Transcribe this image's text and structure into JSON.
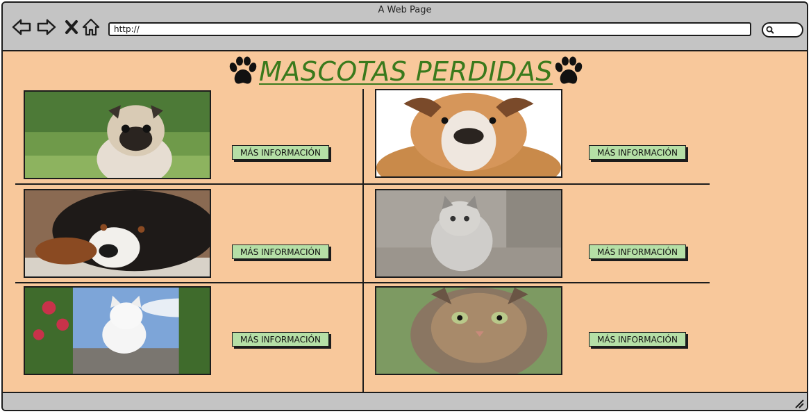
{
  "window": {
    "title": "A Web Page"
  },
  "browser": {
    "url": "http://",
    "icons": [
      "back-arrow-icon",
      "forward-arrow-icon",
      "close-x-icon",
      "home-icon",
      "search-icon",
      "resize-grip-icon"
    ]
  },
  "page": {
    "title": "MASCOTAS PERDIDAS",
    "title_color": "#3a7a1c",
    "background": "#f8c89b",
    "button_color": "#b5dfa6",
    "pets": [
      {
        "image": "pug-dog-photo",
        "button": "MÁS INFORMACIÓN"
      },
      {
        "image": "bulldog-photo",
        "button": "MÁS INFORMACIÓN"
      },
      {
        "image": "bernese-dog-photo",
        "button": "MÁS INFORMACIÓN"
      },
      {
        "image": "gray-kitten-photo",
        "button": "MÁS INFORMACIÓN"
      },
      {
        "image": "white-cat-photo",
        "button": "MÁS INFORMACIÓN"
      },
      {
        "image": "tabby-cat-photo",
        "button": "MÁS INFORMACIÓN"
      }
    ]
  }
}
